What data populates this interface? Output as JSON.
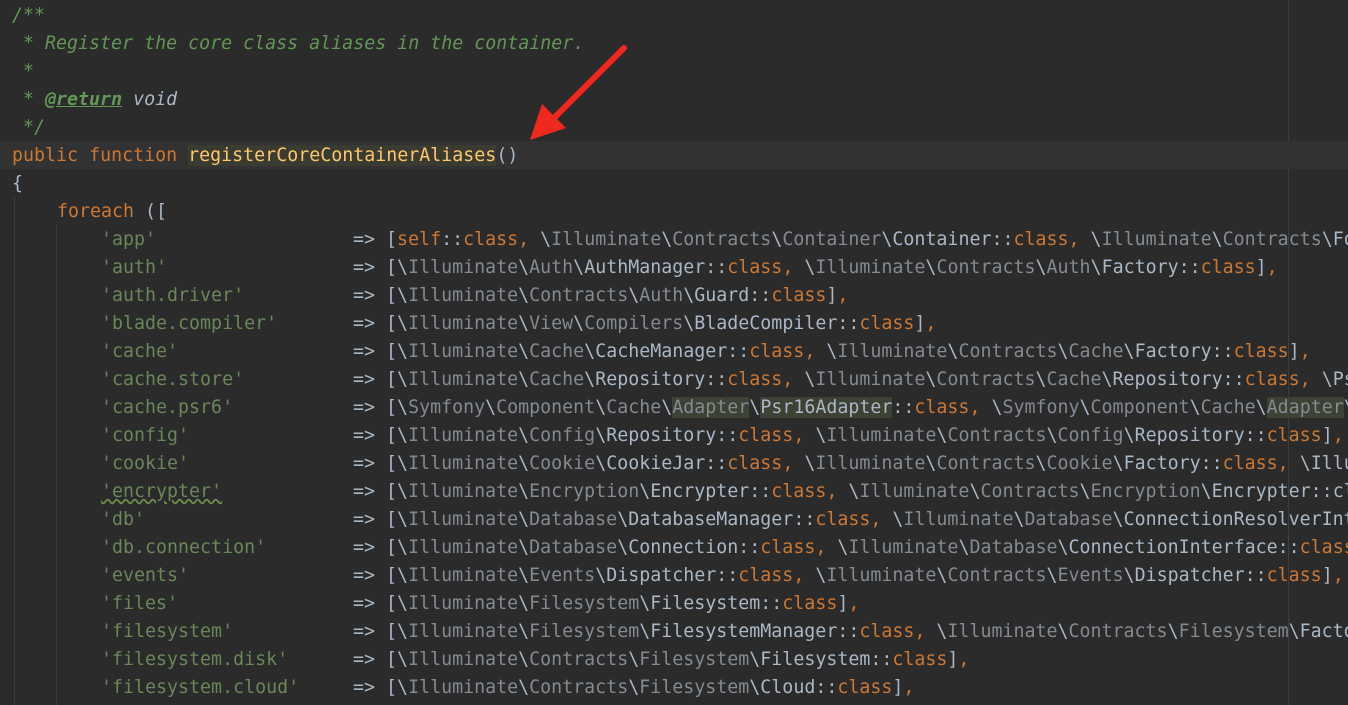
{
  "doc": {
    "open": "/**",
    "desc": " * Register the core class aliases in the container.",
    "star": " *",
    "ret_prefix": " * ",
    "ret_tag": "@return",
    "ret_type": " void",
    "close": " */"
  },
  "sig": {
    "kw1": "public",
    "kw2": "function",
    "name": "registerCoreContainerAliases",
    "parens": "()"
  },
  "brace": "{",
  "foreach": {
    "kw": "foreach",
    "open": " (["
  },
  "arrow_op": "=> ",
  "rows": [
    {
      "key": "'app'",
      "value": "[self::class, \\Illuminate\\Contracts\\Container\\Container::class, \\Illuminate\\Contracts\\Fo"
    },
    {
      "key": "'auth'",
      "value": "[\\Illuminate\\Auth\\AuthManager::class, \\Illuminate\\Contracts\\Auth\\Factory::class],"
    },
    {
      "key": "'auth.driver'",
      "value": "[\\Illuminate\\Contracts\\Auth\\Guard::class],"
    },
    {
      "key": "'blade.compiler'",
      "value": "[\\Illuminate\\View\\Compilers\\BladeCompiler::class],"
    },
    {
      "key": "'cache'",
      "value": "[\\Illuminate\\Cache\\CacheManager::class, \\Illuminate\\Contracts\\Cache\\Factory::class],"
    },
    {
      "key": "'cache.store'",
      "value": "[\\Illuminate\\Cache\\Repository::class, \\Illuminate\\Contracts\\Cache\\Repository::class, \\Psr"
    },
    {
      "key": "'cache.psr6'",
      "value": "[\\Symfony\\Component\\Cache\\Adapter\\Psr16Adapter::class, \\Symfony\\Component\\Cache\\Adapter\\"
    },
    {
      "key": "'config'",
      "value": "[\\Illuminate\\Config\\Repository::class, \\Illuminate\\Contracts\\Config\\Repository::class],"
    },
    {
      "key": "'cookie'",
      "value": "[\\Illuminate\\Cookie\\CookieJar::class, \\Illuminate\\Contracts\\Cookie\\Factory::class, \\Illu"
    },
    {
      "key": "'encrypter'",
      "value": "[\\Illuminate\\Encryption\\Encrypter::class, \\Illuminate\\Contracts\\Encryption\\Encrypter::cl"
    },
    {
      "key": "'db'",
      "value": "[\\Illuminate\\Database\\DatabaseManager::class, \\Illuminate\\Database\\ConnectionResolverInt"
    },
    {
      "key": "'db.connection'",
      "value": "[\\Illuminate\\Database\\Connection::class, \\Illuminate\\Database\\ConnectionInterface::class"
    },
    {
      "key": "'events'",
      "value": "[\\Illuminate\\Events\\Dispatcher::class, \\Illuminate\\Contracts\\Events\\Dispatcher::class],"
    },
    {
      "key": "'files'",
      "value": "[\\Illuminate\\Filesystem\\Filesystem::class],"
    },
    {
      "key": "'filesystem'",
      "value": "[\\Illuminate\\Filesystem\\FilesystemManager::class, \\Illuminate\\Contracts\\Filesystem\\Facto"
    },
    {
      "key": "'filesystem.disk'",
      "value": "[\\Illuminate\\Contracts\\Filesystem\\Filesystem::class],"
    },
    {
      "key": "'filesystem.cloud'",
      "value": "[\\Illuminate\\Contracts\\Filesystem\\Cloud::class],"
    }
  ],
  "colors": {
    "background": "#2b2b2b",
    "current_line": "#323232",
    "keyword": "#cc7832",
    "string": "#6a8759",
    "comment": "#629755",
    "function_name": "#ffc66d",
    "namespace": "#838a91",
    "identifier": "#a9b7c6",
    "annotation_arrow": "#f0291f"
  }
}
